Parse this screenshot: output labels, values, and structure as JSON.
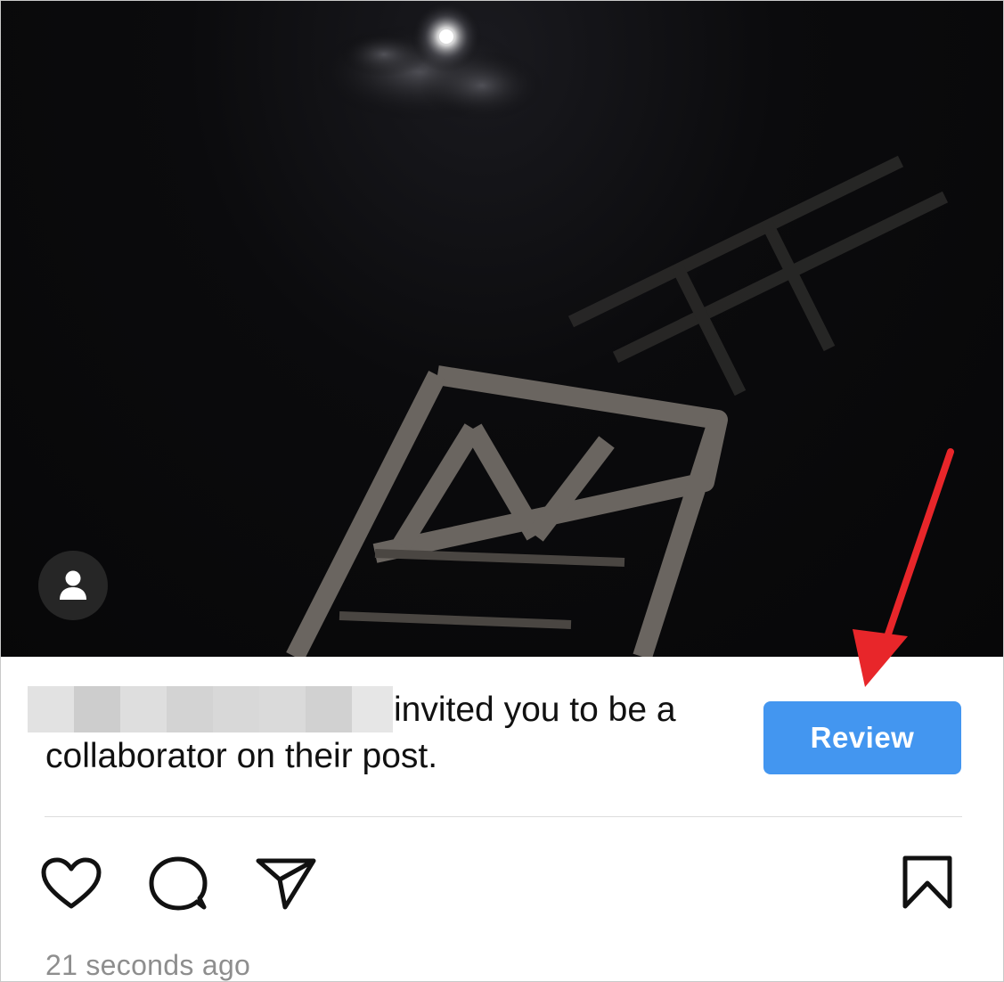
{
  "invite": {
    "message": "invited you to be a collaborator on their post.",
    "review_label": "Review"
  },
  "post": {
    "timestamp": "21 seconds ago"
  },
  "icons": {
    "tag": "person-icon",
    "like": "heart-icon",
    "comment": "comment-bubble-icon",
    "share": "paper-plane-icon",
    "save": "bookmark-icon"
  },
  "colors": {
    "review_button": "#4396f0",
    "annotation_arrow": "#e8262a",
    "timestamp": "#8e8e8e"
  }
}
